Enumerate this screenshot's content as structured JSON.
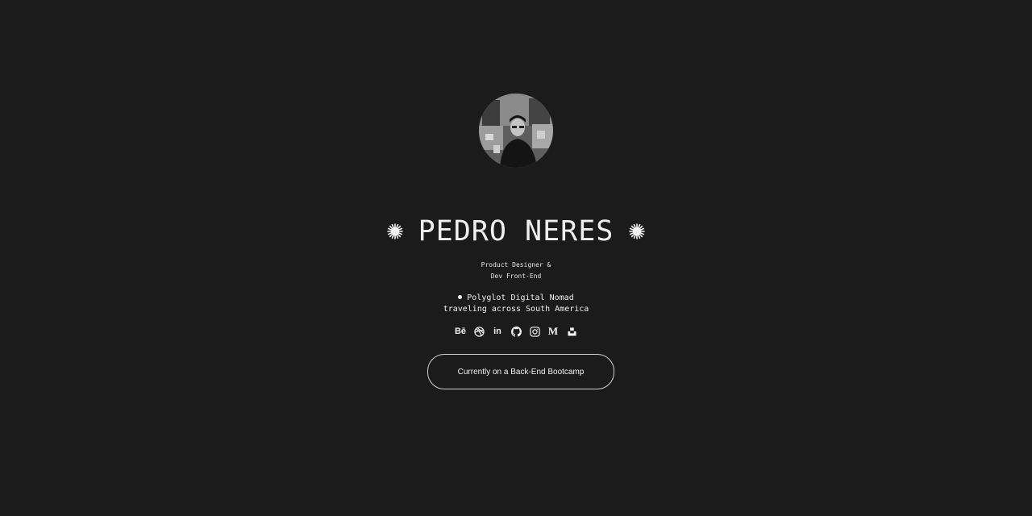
{
  "profile": {
    "name": "PEDRO NERES",
    "role_line_1": "Product Designer &",
    "role_line_2": "Dev Front-End",
    "tagline_line_1": "Polyglot Digital Nomad",
    "tagline_line_2": "traveling across South America"
  },
  "social_links": [
    {
      "name": "behance",
      "label": "Bē",
      "icon": "behance-icon"
    },
    {
      "name": "dribbble",
      "label": "",
      "icon": "dribbble-icon"
    },
    {
      "name": "linkedin",
      "label": "in",
      "icon": "linkedin-icon"
    },
    {
      "name": "github",
      "label": "",
      "icon": "github-icon"
    },
    {
      "name": "instagram",
      "label": "",
      "icon": "instagram-icon"
    },
    {
      "name": "medium",
      "label": "M",
      "icon": "medium-icon"
    },
    {
      "name": "unsplash",
      "label": "",
      "icon": "unsplash-icon"
    }
  ],
  "cta": {
    "label": "Currently on a Back-End Bootcamp"
  },
  "colors": {
    "background": "#1b1b1b",
    "foreground": "#ececec"
  }
}
